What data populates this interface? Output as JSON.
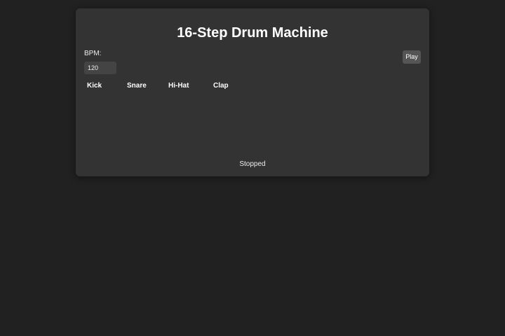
{
  "app": {
    "title": "16-Step Drum Machine"
  },
  "controls": {
    "bpm_label": "BPM:",
    "bpm_value": "120",
    "play_label": "Play"
  },
  "tracks": [
    {
      "label": "Kick"
    },
    {
      "label": "Snare"
    },
    {
      "label": "Hi-Hat"
    },
    {
      "label": "Clap"
    }
  ],
  "status": {
    "text": "Stopped"
  },
  "colors": {
    "page_background": "#212121",
    "panel_background": "#333333",
    "input_background": "#444444",
    "button_background": "#555555",
    "text": "#ffffff"
  }
}
